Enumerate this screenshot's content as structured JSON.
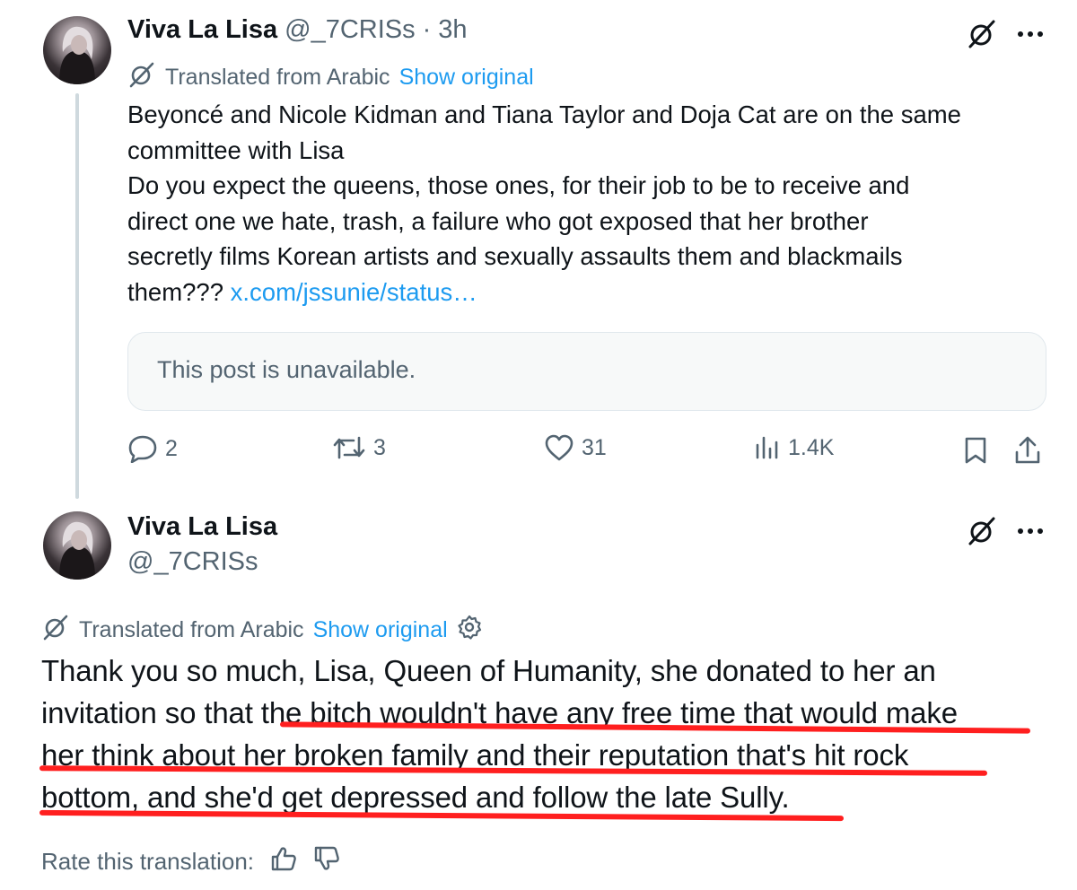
{
  "post1": {
    "display_name": "Viva La Lisa",
    "handle": "@_7CRISs",
    "separator": "·",
    "time": "3h",
    "translated_label": "Translated from Arabic",
    "show_original": "Show original",
    "text_lines": [
      "Beyoncé and Nicole Kidman and Tiana Taylor and Doja Cat are on the same",
      "committee with Lisa",
      "Do you expect the queens, those ones, for their job to be to receive and",
      "direct one we hate, trash, a failure who got exposed that her brother",
      "secretly films Korean artists and sexually assaults them and blackmails"
    ],
    "last_line_text": "them???",
    "link_text": "x.com/jssunie/status…",
    "quote_unavailable": "This post is unavailable.",
    "actions": {
      "replies": "2",
      "reposts": "3",
      "likes": "31",
      "views": "1.4K"
    }
  },
  "post2": {
    "display_name": "Viva La Lisa",
    "handle": "@_7CRISs",
    "translated_label": "Translated from Arabic",
    "show_original": "Show original",
    "line1": "Thank you so much, Lisa, Queen of Humanity, she donated to her an",
    "line2_plain": "invitation so that ",
    "line2_underlined": "the bitch wouldn't have any free time that would make",
    "line3": "her think about her broken family and their reputation that's hit rock",
    "line4": "bottom, and she'd get depressed and follow the late Sully.",
    "rate_label": "Rate this translation:"
  },
  "colors": {
    "accent_blue": "#1d9bf0",
    "muted_text": "#536471",
    "annotation_red": "#ff1f1f"
  },
  "icons": [
    "grok-icon",
    "more-icon",
    "translate-icon",
    "reply-icon",
    "repost-icon",
    "like-icon",
    "views-icon",
    "bookmark-icon",
    "share-icon",
    "gear-icon",
    "thumbs-up-icon",
    "thumbs-down-icon"
  ]
}
